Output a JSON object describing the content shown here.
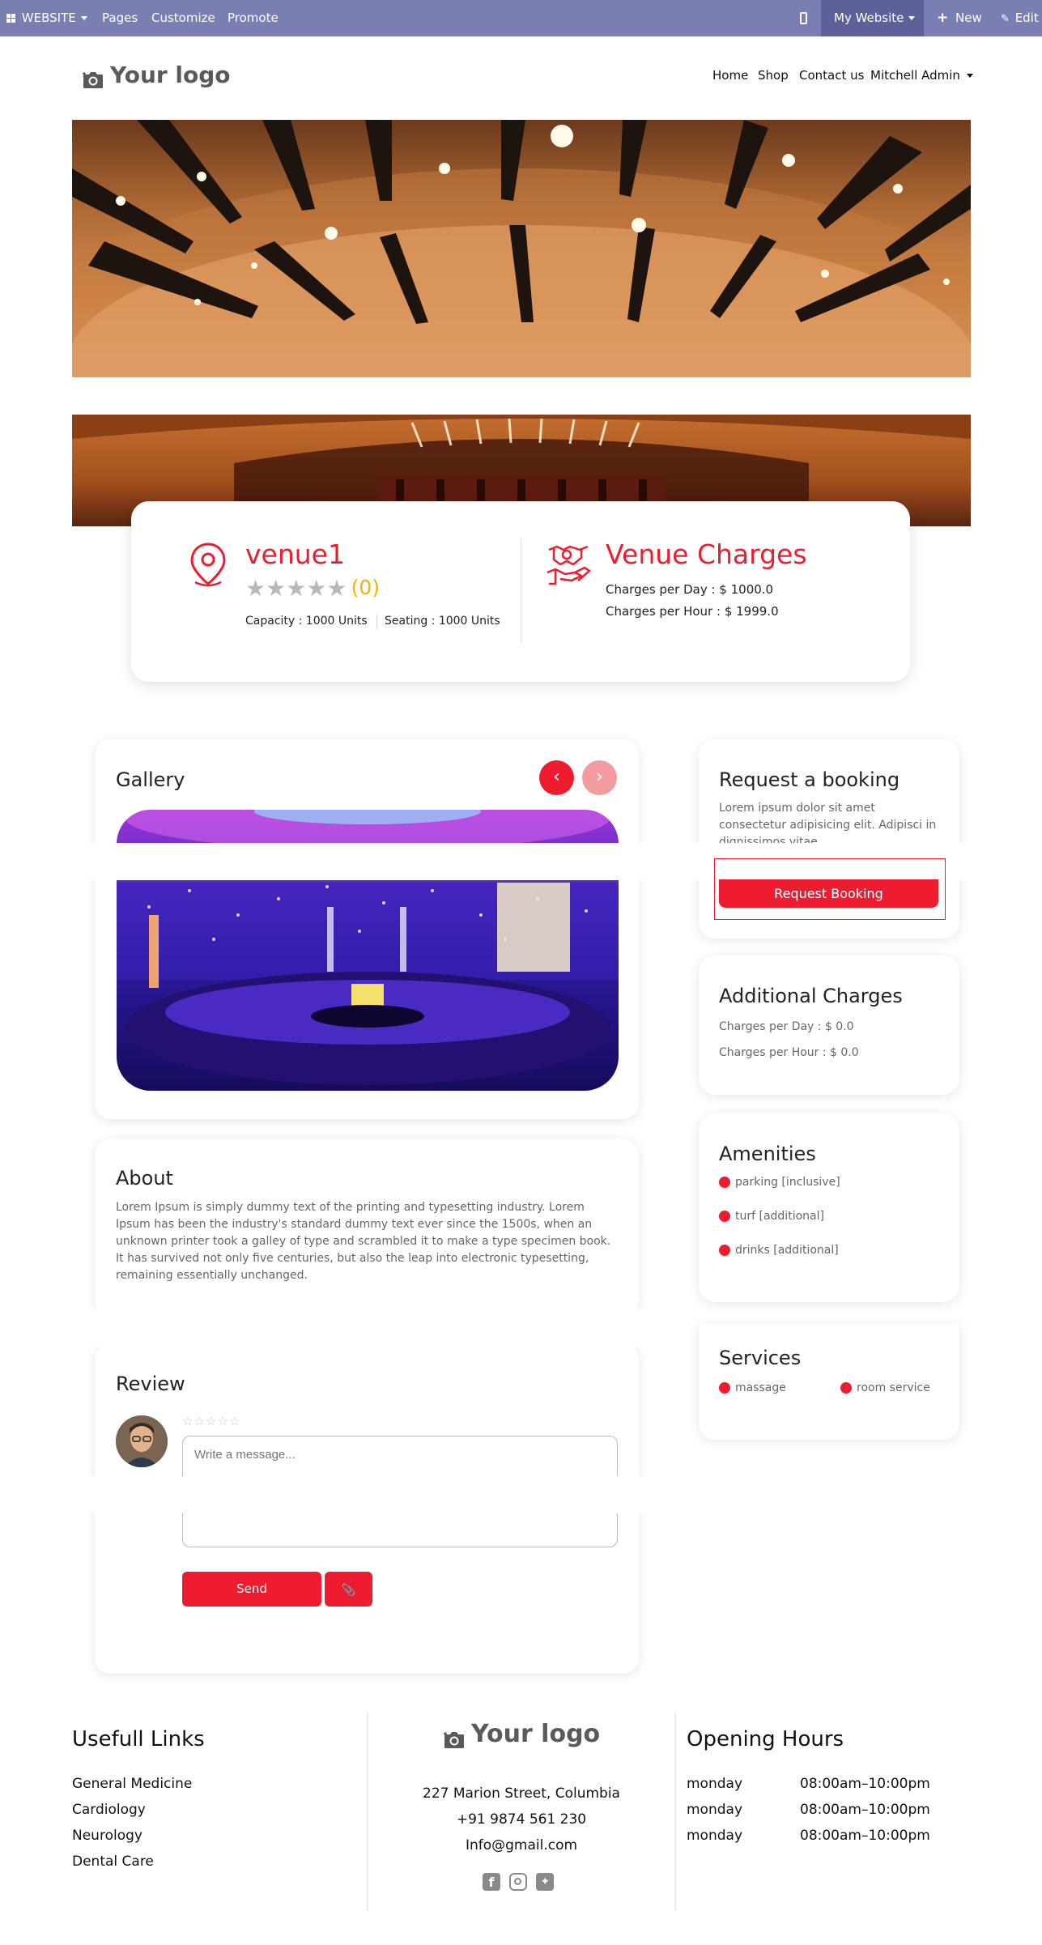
{
  "adminbar": {
    "apps_label": "WEBSITE",
    "pages": "Pages",
    "customize": "Customize",
    "promote": "Promote",
    "my_website": "My Website",
    "new": "New",
    "edit": "Edit"
  },
  "header": {
    "logo_text": "Your logo",
    "nav": [
      "Home",
      "Shop",
      "Contact us",
      "Mitchell Admin"
    ]
  },
  "venue": {
    "name": "venue1",
    "rating_count": "(0)",
    "capacity": "Capacity : 1000 Units",
    "seating": "Seating : 1000 Units",
    "charges_title": "Venue Charges",
    "per_day": "Charges per Day : $ 1000.0",
    "per_hour": "Charges per Hour : $ 1999.0"
  },
  "gallery": {
    "title": "Gallery"
  },
  "booking": {
    "title": "Request a booking",
    "text_line1": "Lorem ipsum dolor sit amet",
    "text_line2": "consectetur adipisicing elit. Adipisci in",
    "text_line3": "dignissimos vitae",
    "button": "Request Booking"
  },
  "additional": {
    "title": "Additional Charges",
    "per_day": "Charges per Day : $ 0.0",
    "per_hour": "Charges per Hour : $ 0.0"
  },
  "amenities": {
    "title": "Amenities",
    "items": [
      "parking [inclusive]",
      "turf [additional]",
      "drinks [additional]"
    ]
  },
  "services": {
    "title": "Services",
    "items": [
      "massage",
      "room service"
    ]
  },
  "about": {
    "title": "About",
    "lines": [
      "Lorem Ipsum is simply dummy text of the printing and typesetting industry. Lorem",
      "Ipsum has been the industry's standard dummy text ever since the 1500s, when an",
      "unknown printer took a galley of type and scrambled it to make a type specimen book.",
      "It has survived not only five centuries, but also the leap into electronic typesetting,",
      "remaining essentially unchanged."
    ]
  },
  "review": {
    "title": "Review",
    "placeholder": "Write a message...",
    "send": "Send"
  },
  "footer": {
    "links_title": "Usefull Links",
    "links": [
      "General Medicine",
      "Cardiology",
      "Neurology",
      "Dental Care"
    ],
    "logo_text": "Your logo",
    "address": "227 Marion Street, Columbia",
    "phone": "+91 9874 561 230",
    "email": "Info@gmail.com",
    "hours_title": "Opening Hours",
    "hours": [
      {
        "day": "monday",
        "time": "08:00am–10:00pm"
      },
      {
        "day": "monday",
        "time": "08:00am–10:00pm"
      },
      {
        "day": "monday",
        "time": "08:00am–10:00pm"
      }
    ]
  },
  "colors": {
    "accent": "#ee1c2f",
    "adminbar": "#7a7fb3",
    "star": "#f5b301"
  }
}
